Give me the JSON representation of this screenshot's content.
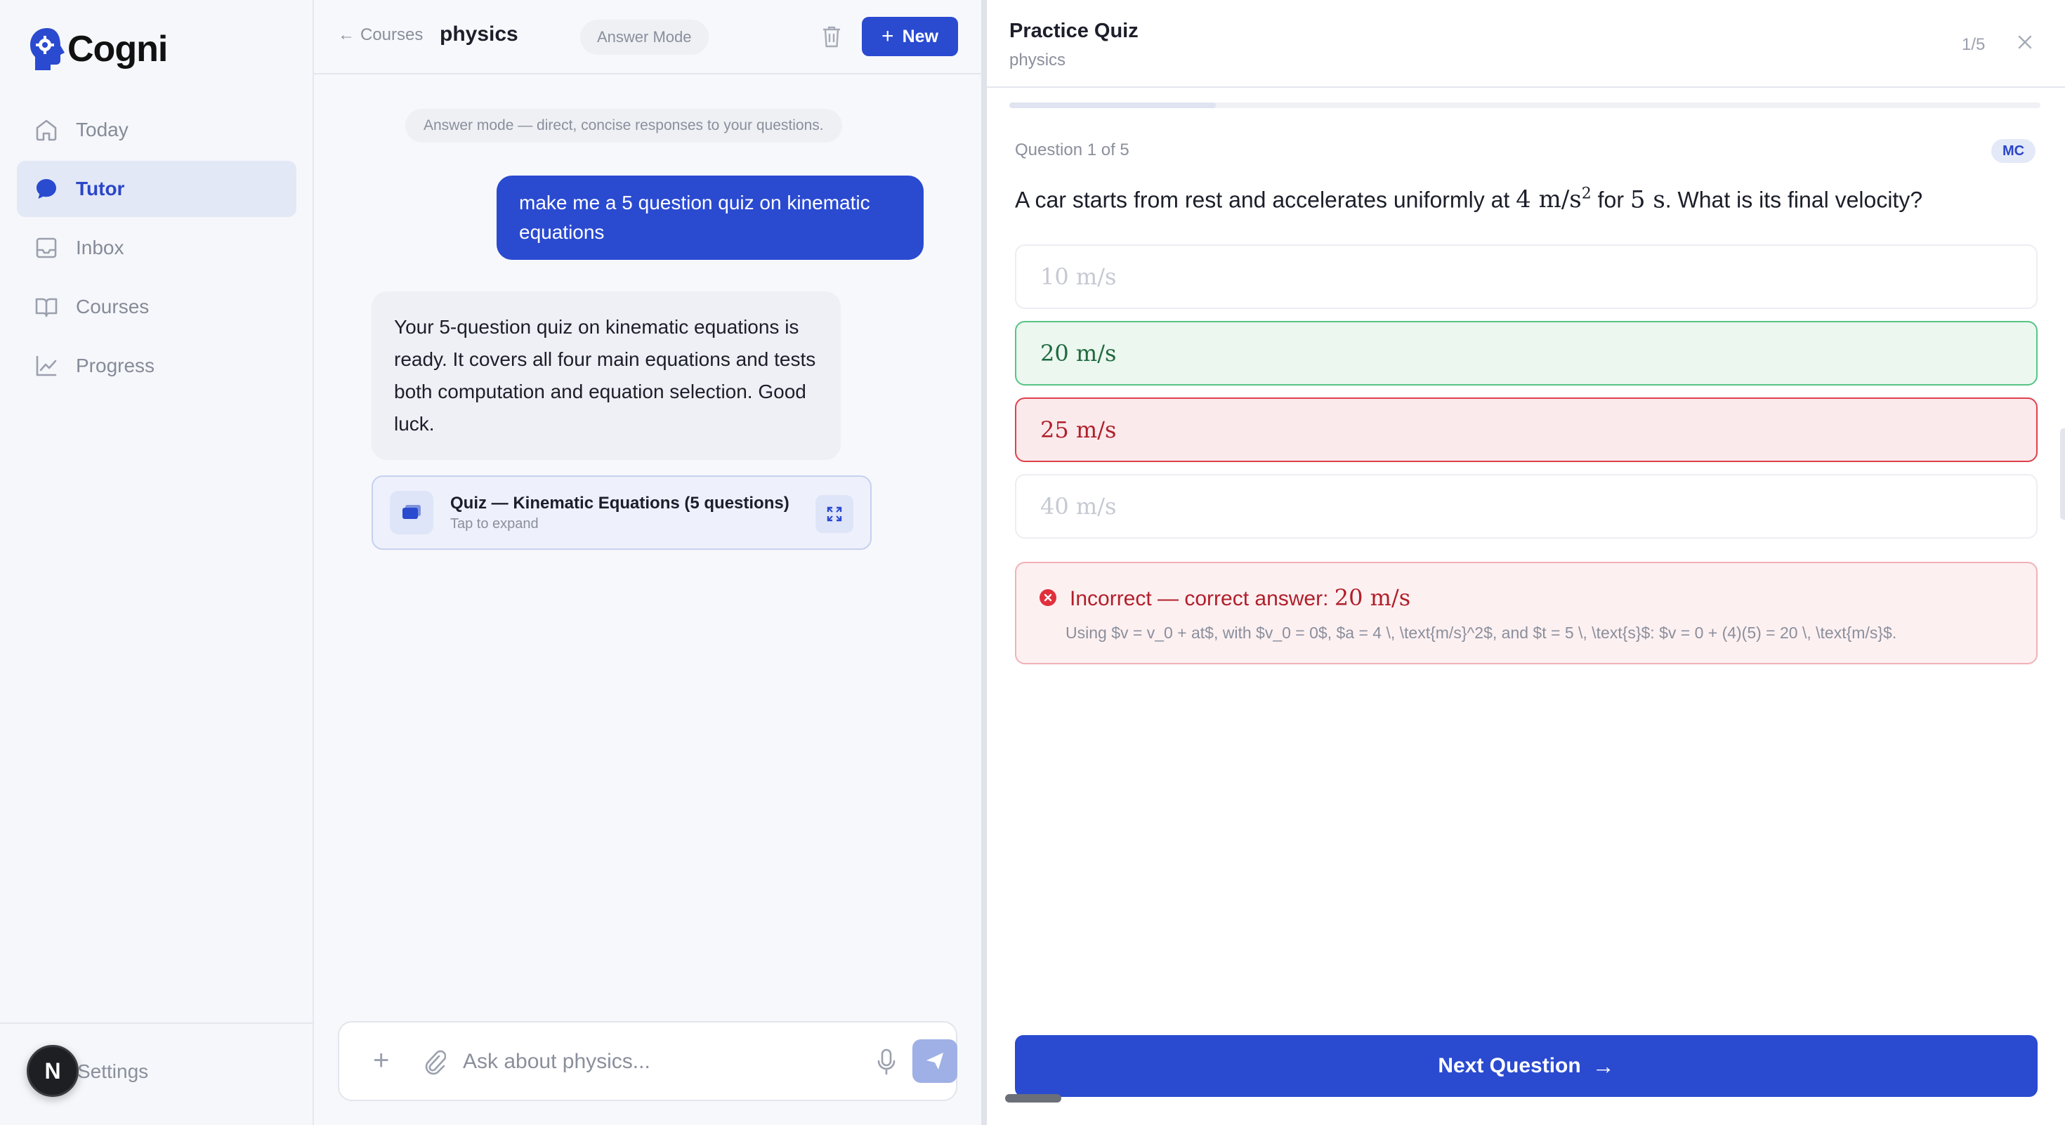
{
  "brand": {
    "name": "Cogni",
    "accent": "#2a4ad0"
  },
  "sidebar": {
    "items": [
      {
        "label": "Today",
        "icon": "home-icon"
      },
      {
        "label": "Tutor",
        "icon": "chat-bubble-icon",
        "active": true
      },
      {
        "label": "Inbox",
        "icon": "inbox-icon"
      },
      {
        "label": "Courses",
        "icon": "book-icon"
      },
      {
        "label": "Progress",
        "icon": "chart-icon"
      }
    ],
    "settings_label": "Settings",
    "avatar_initial": "N"
  },
  "chat": {
    "back_label": "Courses",
    "title": "physics",
    "mode_pill": "Answer Mode",
    "new_label": "New",
    "mode_note": "Answer mode — direct, concise responses to your questions.",
    "messages": [
      {
        "role": "user",
        "text": "make me a 5 question quiz on kinematic equations"
      },
      {
        "role": "assistant",
        "text": "Your 5-question quiz on kinematic equations is ready. It covers all four main equations and tests both computation and equation selection. Good luck."
      }
    ],
    "quiz_card": {
      "title": "Quiz — Kinematic Equations (5 questions)",
      "subtitle": "Tap to expand"
    },
    "composer": {
      "placeholder": "Ask about physics..."
    }
  },
  "quiz": {
    "title": "Practice Quiz",
    "subtitle": "physics",
    "counter": "1/5",
    "progress": 0.2,
    "question_label": "Question 1 of 5",
    "type_badge": "MC",
    "question": {
      "text_before": "A car starts from rest and accelerates uniformly at ",
      "accel": "4 m/s",
      "accel_exp": "2",
      "text_mid": " for ",
      "time": "5 s",
      "text_after": ". What is its final velocity?"
    },
    "options": [
      {
        "label": "10 m/s",
        "state": "neutral"
      },
      {
        "label": "20 m/s",
        "state": "correct"
      },
      {
        "label": "25 m/s",
        "state": "wrong"
      },
      {
        "label": "40 m/s",
        "state": "neutral"
      }
    ],
    "feedback": {
      "headline": "Incorrect — correct answer: ",
      "answer": "20 m/s",
      "explanation": "Using $v = v_0 + at$, with $v_0 = 0$, $a = 4 \\, \\text{m/s}^2$, and $t = 5 \\, \\text{s}$: $v = 0 + (4)(5) = 20 \\, \\text{m/s}$."
    },
    "next_label": "Next Question"
  }
}
